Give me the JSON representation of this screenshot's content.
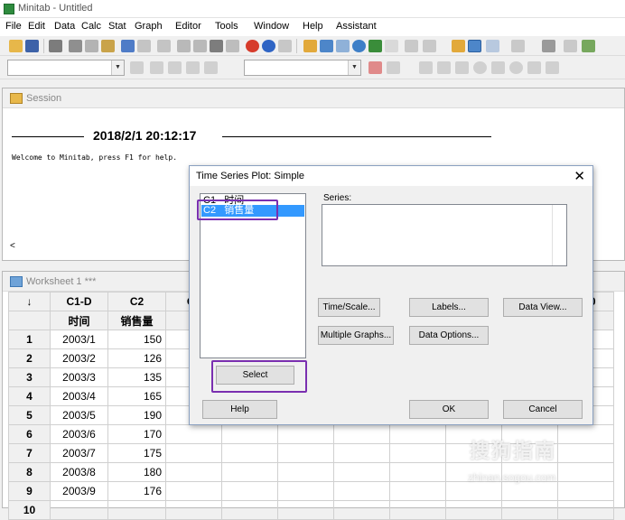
{
  "app": {
    "title": "Minitab - Untitled"
  },
  "menu": [
    "File",
    "Edit",
    "Data",
    "Calc",
    "Stat",
    "Graph",
    "Editor",
    "Tools",
    "Window",
    "Help",
    "Assistant"
  ],
  "session": {
    "title": "Session",
    "datetime": "2018/2/1 20:12:17",
    "welcome": "Welcome to Minitab, press F1 for help.",
    "scroll_left": "<"
  },
  "worksheet": {
    "title": "Worksheet 1 ***",
    "corner": "↓",
    "col_ids": [
      "C1-D",
      "C2",
      "C3",
      "",
      "",
      "",
      "",
      "",
      "",
      "C10"
    ],
    "col_names": [
      "时间",
      "销售量"
    ],
    "rows": [
      {
        "n": "1",
        "c1": "2003/1",
        "c2": "150"
      },
      {
        "n": "2",
        "c1": "2003/2",
        "c2": "126"
      },
      {
        "n": "3",
        "c1": "2003/3",
        "c2": "135"
      },
      {
        "n": "4",
        "c1": "2003/4",
        "c2": "165"
      },
      {
        "n": "5",
        "c1": "2003/5",
        "c2": "190"
      },
      {
        "n": "6",
        "c1": "2003/6",
        "c2": "170"
      },
      {
        "n": "7",
        "c1": "2003/7",
        "c2": "175"
      },
      {
        "n": "8",
        "c1": "2003/8",
        "c2": "180"
      },
      {
        "n": "9",
        "c1": "2003/9",
        "c2": "176"
      },
      {
        "n": "10",
        "c1": "",
        "c2": ""
      }
    ]
  },
  "dialog": {
    "title": "Time Series Plot: Simple",
    "close": "✕",
    "variables": [
      {
        "id": "C1",
        "name": "时间"
      },
      {
        "id": "C2",
        "name": "销售量"
      }
    ],
    "series_label": "Series:",
    "buttons": {
      "time_scale": "Time/Scale...",
      "labels": "Labels...",
      "data_view": "Data View...",
      "multiple_graphs": "Multiple Graphs...",
      "data_options": "Data Options...",
      "select": "Select",
      "help": "Help",
      "ok": "OK",
      "cancel": "Cancel"
    }
  },
  "watermark": {
    "line1": "搜狗指南",
    "line2": "zhinan.sogou.com"
  },
  "colors": {
    "selection": "#3399ff",
    "highlight_box": "#7a2fb0"
  }
}
